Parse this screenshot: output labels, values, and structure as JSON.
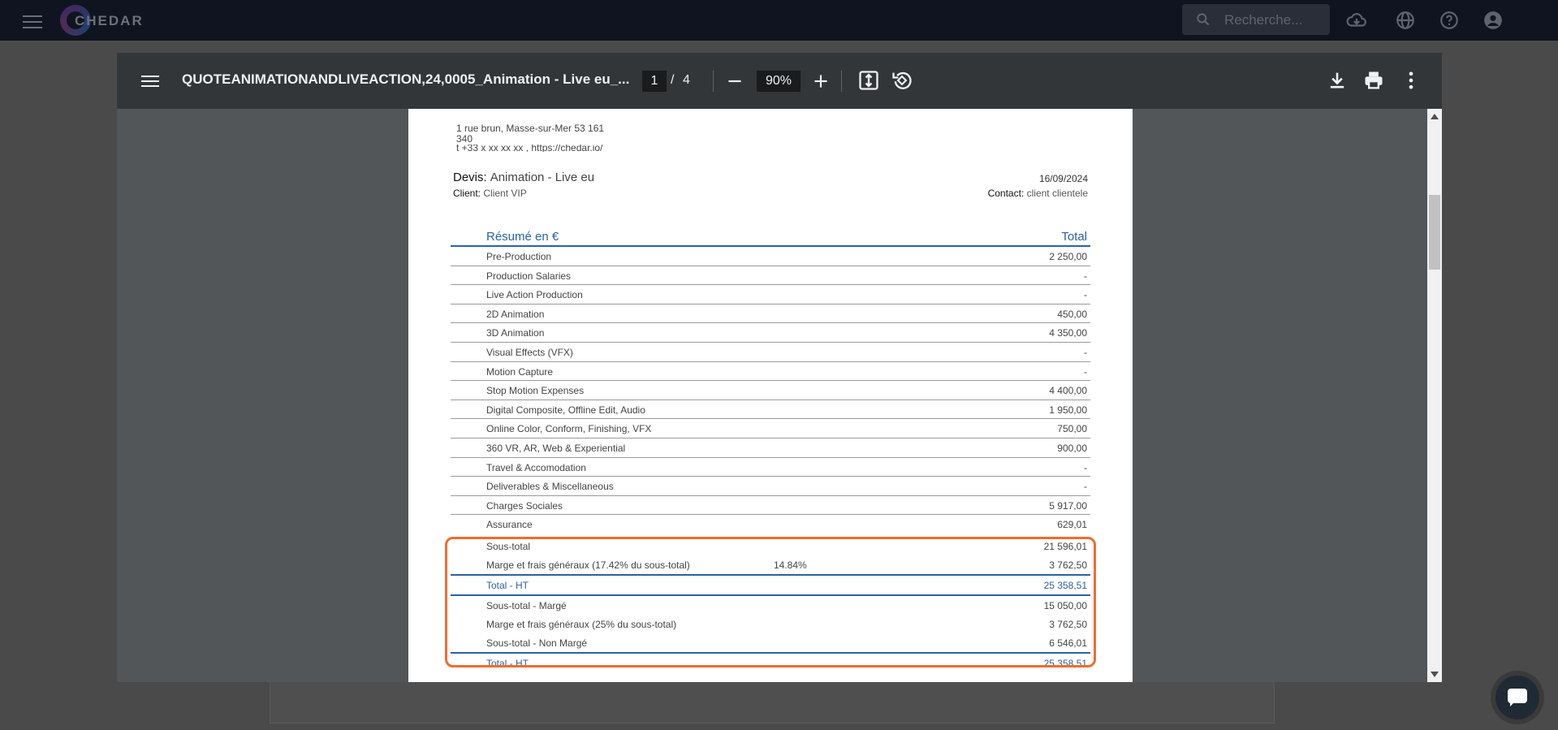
{
  "app": {
    "logo_text": "CHEDAR",
    "search_placeholder": "Recherche..."
  },
  "viewer": {
    "title": "QUOTEANIMATIONANDLIVEACTION,24,0005_Animation - Live eu_...",
    "current_page": "1",
    "page_separator": "/",
    "total_pages": "4",
    "zoom": "90%"
  },
  "document": {
    "address_line1": "1 rue brun, Masse-sur-Mer 53 161",
    "address_line2": "340",
    "address_line3": "t +33 x xx xx xx , https://chedar.io/",
    "devis_label": "Devis:",
    "devis_value": "Animation - Live eu",
    "date": "16/09/2024",
    "client_label": "Client:",
    "client_value": "Client VIP",
    "contact_label": "Contact:",
    "contact_value": "client clientele",
    "table_header_label": "Résumé en €",
    "table_header_total": "Total",
    "rows": [
      {
        "label": "Pre-Production",
        "value": "2 250,00"
      },
      {
        "label": "Production Salaries",
        "value": "-"
      },
      {
        "label": "Live Action Production",
        "value": "-"
      },
      {
        "label": "2D Animation",
        "value": "450,00"
      },
      {
        "label": "3D Animation",
        "value": "4 350,00"
      },
      {
        "label": "Visual Effects (VFX)",
        "value": "-"
      },
      {
        "label": "Motion Capture",
        "value": "-"
      },
      {
        "label": "Stop Motion Expenses",
        "value": "4 400,00"
      },
      {
        "label": "Digital Composite, Offline Edit, Audio",
        "value": "1 950,00"
      },
      {
        "label": "Online Color, Conform, Finishing, VFX",
        "value": "750,00"
      },
      {
        "label": "360 VR, AR, Web & Experiential",
        "value": "900,00"
      },
      {
        "label": "Travel & Accomodation",
        "value": "-"
      },
      {
        "label": "Deliverables & Miscellaneous",
        "value": "-"
      },
      {
        "label": "Charges Sociales",
        "value": "5 917,00"
      },
      {
        "label": "Assurance",
        "value": "629,01"
      }
    ],
    "summary": [
      {
        "label": "Sous-total",
        "mid": "",
        "value": "21 596,01"
      },
      {
        "label": "Marge et frais généraux (17.42% du sous-total)",
        "mid": "14.84%",
        "value": "3 762,50"
      },
      {
        "label": "Total - HT",
        "mid": "",
        "value": "25 358,51"
      },
      {
        "label": "Sous-total - Margé",
        "mid": "",
        "value": "15 050,00"
      },
      {
        "label": "Marge et frais généraux (25% du sous-total)",
        "mid": "",
        "value": "3 762,50"
      },
      {
        "label": "Sous-total - Non Margé",
        "mid": "",
        "value": "6 546,01"
      },
      {
        "label": "Total - HT",
        "mid": "",
        "value": "25 358,51"
      }
    ]
  },
  "colors": {
    "accent_blue": "#2a62a6",
    "highlight_orange": "#f06c2f",
    "toolbar": "#323639"
  },
  "icons": {
    "app": [
      "menu-icon",
      "search-icon",
      "cloud-download-icon",
      "globe-icon",
      "help-icon",
      "account-icon"
    ],
    "viewer": [
      "menu-icon",
      "zoom-out-icon",
      "zoom-in-icon",
      "fit-page-icon",
      "rotate-icon",
      "download-icon",
      "print-icon",
      "more-vert-icon"
    ],
    "chat": "chat-icon"
  }
}
